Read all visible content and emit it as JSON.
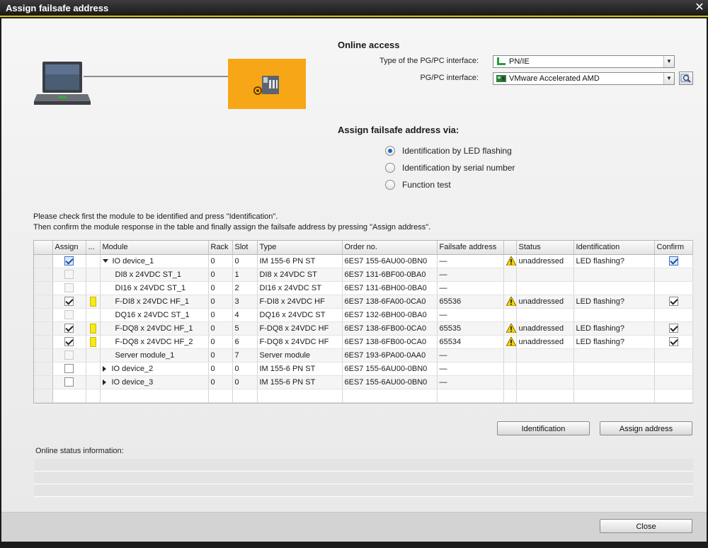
{
  "window": {
    "title": "Assign failsafe address",
    "close_glyph": "✕"
  },
  "online_access": {
    "title": "Online access",
    "interface_type_label": "Type of the PG/PC interface:",
    "interface_type_value": "PN/IE",
    "interface_label": "PG/PC interface:",
    "interface_value": "VMware Accelerated AMD"
  },
  "assign_via": {
    "title": "Assign failsafe address via:",
    "options": [
      {
        "label": "Identification by LED flashing",
        "checked": true
      },
      {
        "label": "Identification by serial number",
        "checked": false
      },
      {
        "label": "Function test",
        "checked": false
      }
    ]
  },
  "instructions": {
    "line1": "Please check first the module to be identified and press \"Identification\".",
    "line2": "Then confirm the module response in the table and finally assign the failsafe address by pressing \"Assign address\"."
  },
  "table": {
    "headers": {
      "assign": "Assign",
      "marker": "...",
      "module": "Module",
      "rack": "Rack",
      "slot": "Slot",
      "type": "Type",
      "order": "Order no.",
      "address": "Failsafe address",
      "status": "Status",
      "identification": "Identification",
      "confirm": "Confirm"
    },
    "rows": [
      {
        "module": "IO device_1",
        "rack": "0",
        "slot": "0",
        "type": "IM 155-6 PN ST",
        "order": "6ES7 155-6AU00-0BN0",
        "address": "—",
        "status": "unaddressed",
        "identification": "LED flashing?"
      },
      {
        "module": "DI8 x 24VDC ST_1",
        "rack": "0",
        "slot": "1",
        "type": "DI8 x 24VDC ST",
        "order": "6ES7 131-6BF00-0BA0",
        "address": "—",
        "status": "",
        "identification": ""
      },
      {
        "module": "DI16 x 24VDC ST_1",
        "rack": "0",
        "slot": "2",
        "type": "DI16 x 24VDC ST",
        "order": "6ES7 131-6BH00-0BA0",
        "address": "—",
        "status": "",
        "identification": ""
      },
      {
        "module": "F-DI8 x 24VDC HF_1",
        "rack": "0",
        "slot": "3",
        "type": "F-DI8 x 24VDC HF",
        "order": "6ES7 138-6FA00-0CA0",
        "address": "65536",
        "status": "unaddressed",
        "identification": "LED flashing?"
      },
      {
        "module": "DQ16 x 24VDC ST_1",
        "rack": "0",
        "slot": "4",
        "type": "DQ16 x 24VDC ST",
        "order": "6ES7 132-6BH00-0BA0",
        "address": "—",
        "status": "",
        "identification": ""
      },
      {
        "module": "F-DQ8 x 24VDC HF_1",
        "rack": "0",
        "slot": "5",
        "type": "F-DQ8 x 24VDC HF",
        "order": "6ES7 138-6FB00-0CA0",
        "address": "65535",
        "status": "unaddressed",
        "identification": "LED flashing?"
      },
      {
        "module": "F-DQ8 x 24VDC HF_2",
        "rack": "0",
        "slot": "6",
        "type": "F-DQ8 x 24VDC HF",
        "order": "6ES7 138-6FB00-0CA0",
        "address": "65534",
        "status": "unaddressed",
        "identification": "LED flashing?"
      },
      {
        "module": "Server module_1",
        "rack": "0",
        "slot": "7",
        "type": "Server module",
        "order": "6ES7 193-6PA00-0AA0",
        "address": "—",
        "status": "",
        "identification": ""
      },
      {
        "module": "IO device_2",
        "rack": "0",
        "slot": "0",
        "type": "IM 155-6 PN ST",
        "order": "6ES7 155-6AU00-0BN0",
        "address": "—",
        "status": "",
        "identification": ""
      },
      {
        "module": "IO device_3",
        "rack": "0",
        "slot": "0",
        "type": "IM 155-6 PN ST",
        "order": "6ES7 155-6AU00-0BN0",
        "address": "—",
        "status": "",
        "identification": ""
      }
    ]
  },
  "buttons": {
    "identification": "Identification",
    "assign_address": "Assign address",
    "close": "Close"
  },
  "status": {
    "label": "Online status information:"
  },
  "colors": {
    "accent_yellow": "#d9c40d",
    "device_orange": "#f7a617",
    "marker_yellow": "#f7e91a"
  }
}
